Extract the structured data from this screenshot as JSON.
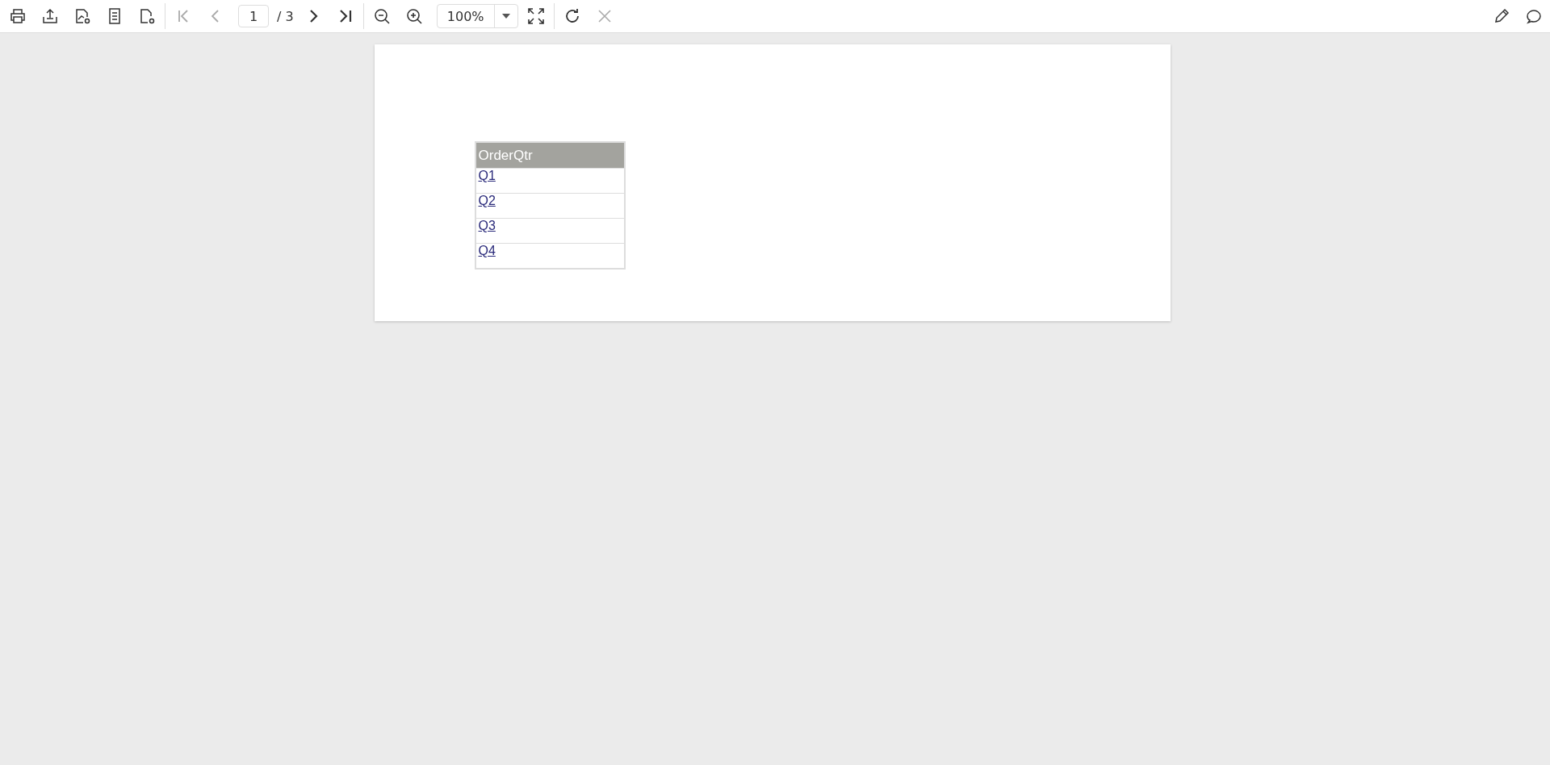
{
  "toolbar": {
    "file_buttons": [
      {
        "kind": "print"
      },
      {
        "kind": "export"
      },
      {
        "kind": "image-settings"
      },
      {
        "kind": "document"
      },
      {
        "kind": "page-settings"
      }
    ],
    "nav_buttons": [
      {
        "kind": "first",
        "disabled": true
      },
      {
        "kind": "previous",
        "disabled": true
      }
    ],
    "page_input": {
      "value": "1"
    },
    "page_count": "/ 3",
    "nav_buttons_after": [
      {
        "kind": "next",
        "disabled": false
      },
      {
        "kind": "last",
        "disabled": false
      }
    ],
    "zoom": {
      "value": "100%"
    },
    "end_buttons": [
      {
        "kind": "refresh",
        "disabled": false
      },
      {
        "kind": "close",
        "disabled": true
      }
    ]
  },
  "report": {
    "table": {
      "columns": [
        "OrderQtr"
      ],
      "rows": [
        {
          "cells": [
            "Q1"
          ]
        },
        {
          "cells": [
            "Q2"
          ]
        },
        {
          "cells": [
            "Q3"
          ]
        },
        {
          "cells": [
            "Q4"
          ]
        }
      ]
    }
  }
}
